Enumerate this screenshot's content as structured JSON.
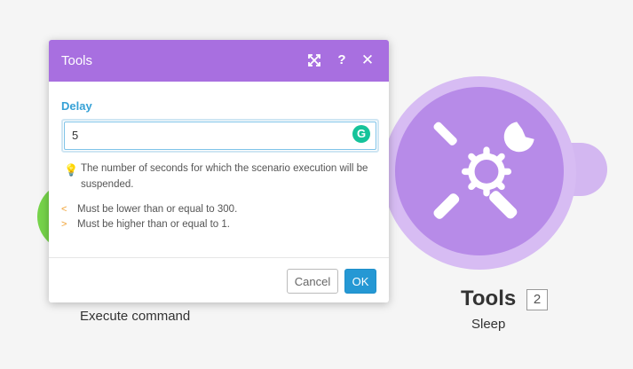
{
  "dialog": {
    "title": "Tools",
    "field_label": "Delay",
    "input_value": "5",
    "hint": "The number of seconds for which the scenario execution will be suspended.",
    "rules": [
      "Must be lower than or equal to 300.",
      "Must be higher than or equal to 1."
    ],
    "cancel_label": "Cancel",
    "ok_label": "OK",
    "grammarly_glyph": "G"
  },
  "canvas": {
    "left_module_label": "Execute command",
    "module_title": "Tools",
    "module_badge": "2",
    "module_subtitle": "Sleep"
  },
  "colors": {
    "header": "#a86fe0",
    "module": "#b78be8",
    "accent_blue": "#36a1d6",
    "ok_button": "#2598d4",
    "green_module": "#76d34a"
  },
  "icons": [
    "expand-icon",
    "help-icon",
    "close-icon",
    "grammarly-icon",
    "lightbulb-icon",
    "chevron-left-icon",
    "chevron-right-icon",
    "tools-icon"
  ]
}
